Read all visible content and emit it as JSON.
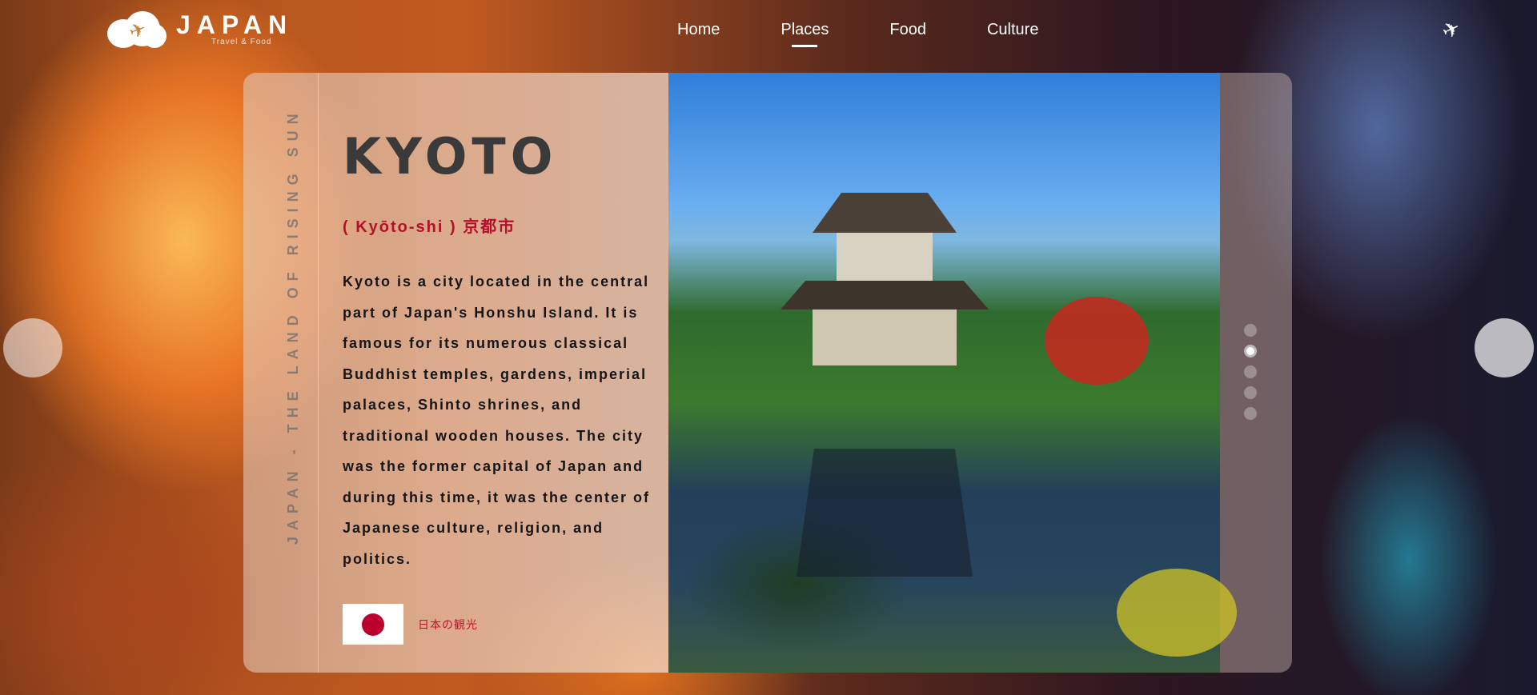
{
  "header": {
    "logo_title": "JAPAN",
    "logo_subtitle": "Travel & Food",
    "nav": [
      {
        "label": "Home"
      },
      {
        "label": "Places"
      },
      {
        "label": "Food"
      },
      {
        "label": "Culture"
      }
    ],
    "active_nav": "Places"
  },
  "card": {
    "vertical_text": "JAPAN - THE LAND OF RISING SUN",
    "city": "KYOTO",
    "romaji": "( Kyōto-shi )   京都市",
    "description": "Kyoto is a city located in the central part of Japan's Honshu Island. It is famous for its numerous classical Buddhist temples, gardens, imperial palaces, Shinto shrines, and traditional wooden houses. The city was the former capital of Japan and during this time, it was the center of Japanese culture, religion, and politics.",
    "flag_label": "日本の観光"
  },
  "carousel": {
    "slide_count": 5,
    "active_index": 1
  },
  "colors": {
    "accent": "#b5102a",
    "flag_red": "#bc002d"
  },
  "icons": {
    "logo": "plane-cloud-logo-icon",
    "header_right": "airplane-icon",
    "prev": "prev-slide-icon",
    "next": "next-slide-icon"
  }
}
